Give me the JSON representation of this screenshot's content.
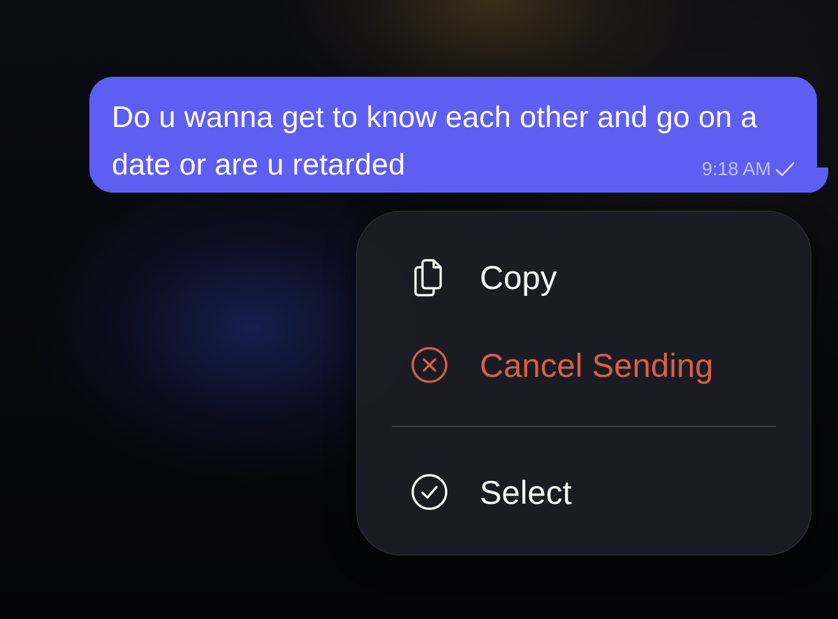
{
  "message": {
    "text": "Do u wanna get to know each other and go on a date or are u retarded",
    "time": "9:18 AM",
    "status_icon": "single-check-icon",
    "bubble_color": "#5e5ef2"
  },
  "context_menu": {
    "items": [
      {
        "label": "Copy",
        "icon": "copy-icon",
        "destructive": false
      },
      {
        "label": "Cancel Sending",
        "icon": "cancel-circle-icon",
        "destructive": true,
        "color": "#d8604a"
      },
      {
        "label": "Select",
        "icon": "checkmark-circle-icon",
        "destructive": false
      }
    ]
  }
}
